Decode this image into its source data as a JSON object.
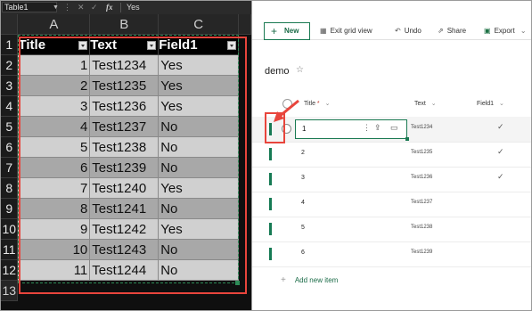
{
  "excel": {
    "name_box": "Table1",
    "formula_value": "Yes",
    "columns": [
      "A",
      "B",
      "C"
    ],
    "headers": [
      "Title",
      "Text",
      "Field1"
    ],
    "row_numbers": [
      "1",
      "2",
      "3",
      "4",
      "5",
      "6",
      "7",
      "8",
      "9",
      "10",
      "11",
      "12",
      "13"
    ],
    "rows": [
      [
        "1",
        "Test1234",
        "Yes"
      ],
      [
        "2",
        "Test1235",
        "Yes"
      ],
      [
        "3",
        "Test1236",
        "Yes"
      ],
      [
        "4",
        "Test1237",
        "No"
      ],
      [
        "5",
        "Test1238",
        "No"
      ],
      [
        "6",
        "Test1239",
        "No"
      ],
      [
        "7",
        "Test1240",
        "Yes"
      ],
      [
        "8",
        "Test1241",
        "No"
      ],
      [
        "9",
        "Test1242",
        "Yes"
      ],
      [
        "10",
        "Test1243",
        "No"
      ],
      [
        "11",
        "Test1244",
        "No"
      ]
    ]
  },
  "sharepoint": {
    "new_label": "New",
    "exit_grid_label": "Exit grid view",
    "undo_label": "Undo",
    "share_label": "Share",
    "export_label": "Export",
    "list_title": "demo",
    "columns": [
      "Title",
      "Text",
      "Field1"
    ],
    "title_required_mark": "*",
    "rows": [
      {
        "title": "1",
        "text": "Test1234",
        "field1": "✓"
      },
      {
        "title": "2",
        "text": "Test1235",
        "field1": "✓"
      },
      {
        "title": "3",
        "text": "Test1236",
        "field1": "✓"
      },
      {
        "title": "4",
        "text": "Test1237",
        "field1": ""
      },
      {
        "title": "5",
        "text": "Test1238",
        "field1": ""
      },
      {
        "title": "6",
        "text": "Test1239",
        "field1": ""
      }
    ],
    "add_new_label": "Add new item"
  },
  "colors": {
    "accent_green": "#1a7a52",
    "annotation_red": "#e8453c"
  }
}
